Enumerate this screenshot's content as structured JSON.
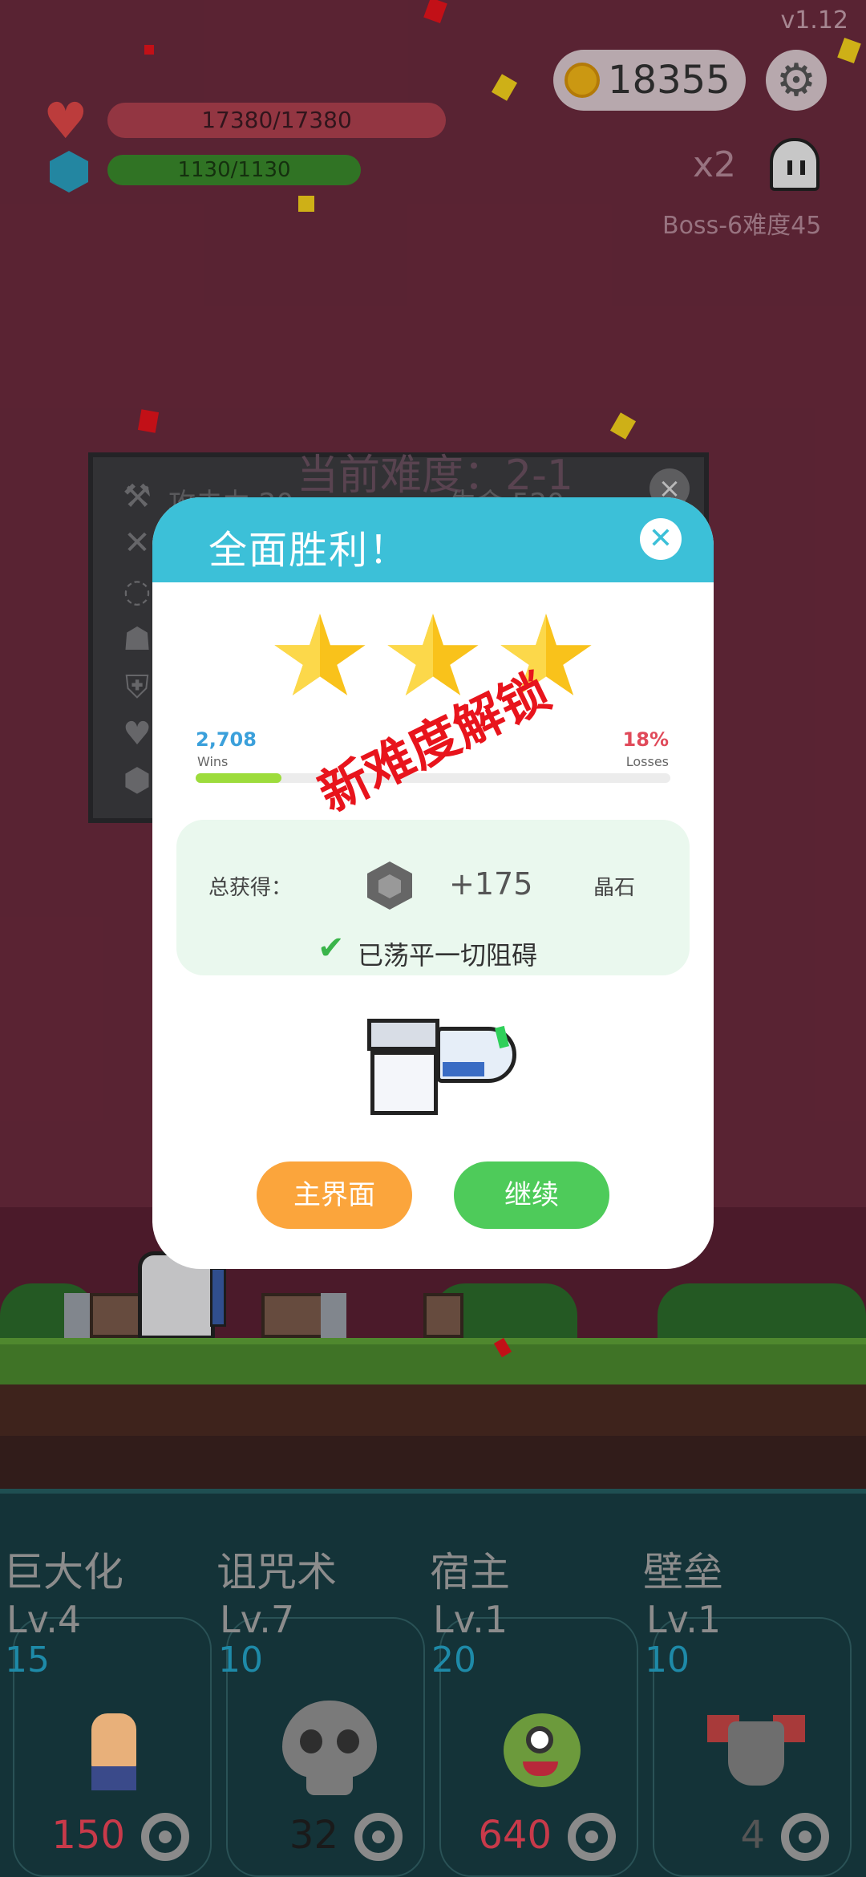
{
  "version": "v1.12",
  "hud": {
    "coins": "18355",
    "hp": "17380/17380",
    "mp": "1130/1130",
    "speed": "x2",
    "stage": "Boss-6难度45"
  },
  "difficulty_panel": {
    "title": "当前难度：2-1",
    "attack": "攻击力 20",
    "health": "生命 520"
  },
  "result": {
    "title": "全面胜利！",
    "stars": 3,
    "wins_value": "2,708",
    "wins_label": "Wins",
    "losses_value": "18%",
    "losses_label": "Losses",
    "win_progress": 0.18,
    "reward_label": "总获得：",
    "reward_amount": "+175",
    "reward_unit": "晶石",
    "cleared_text": "已荡平一切阻碍",
    "unlock_stamp": "新难度解锁",
    "home_button": "主界面",
    "continue_button": "继续"
  },
  "skills": [
    {
      "name": "巨大化",
      "level": "Lv.4",
      "cost": "15",
      "price": "150",
      "price_color": "#c83a4a",
      "icon": "fist-icon"
    },
    {
      "name": "诅咒术",
      "level": "Lv.7",
      "cost": "10",
      "price": "32",
      "price_color": "#1a1a1a",
      "icon": "skull-icon"
    },
    {
      "name": "宿主",
      "level": "Lv.1",
      "cost": "20",
      "price": "640",
      "price_color": "#c83a4a",
      "icon": "monster-icon"
    },
    {
      "name": "壁垒",
      "level": "Lv.1",
      "cost": "10",
      "price": "4",
      "price_color": "#555555",
      "icon": "armor-icon"
    }
  ],
  "colors": {
    "header": "#3cc0d8",
    "star": "#f9c21b",
    "home_button": "#fba53c",
    "continue_button": "#4ecb5a",
    "stamp": "#e8141c"
  }
}
